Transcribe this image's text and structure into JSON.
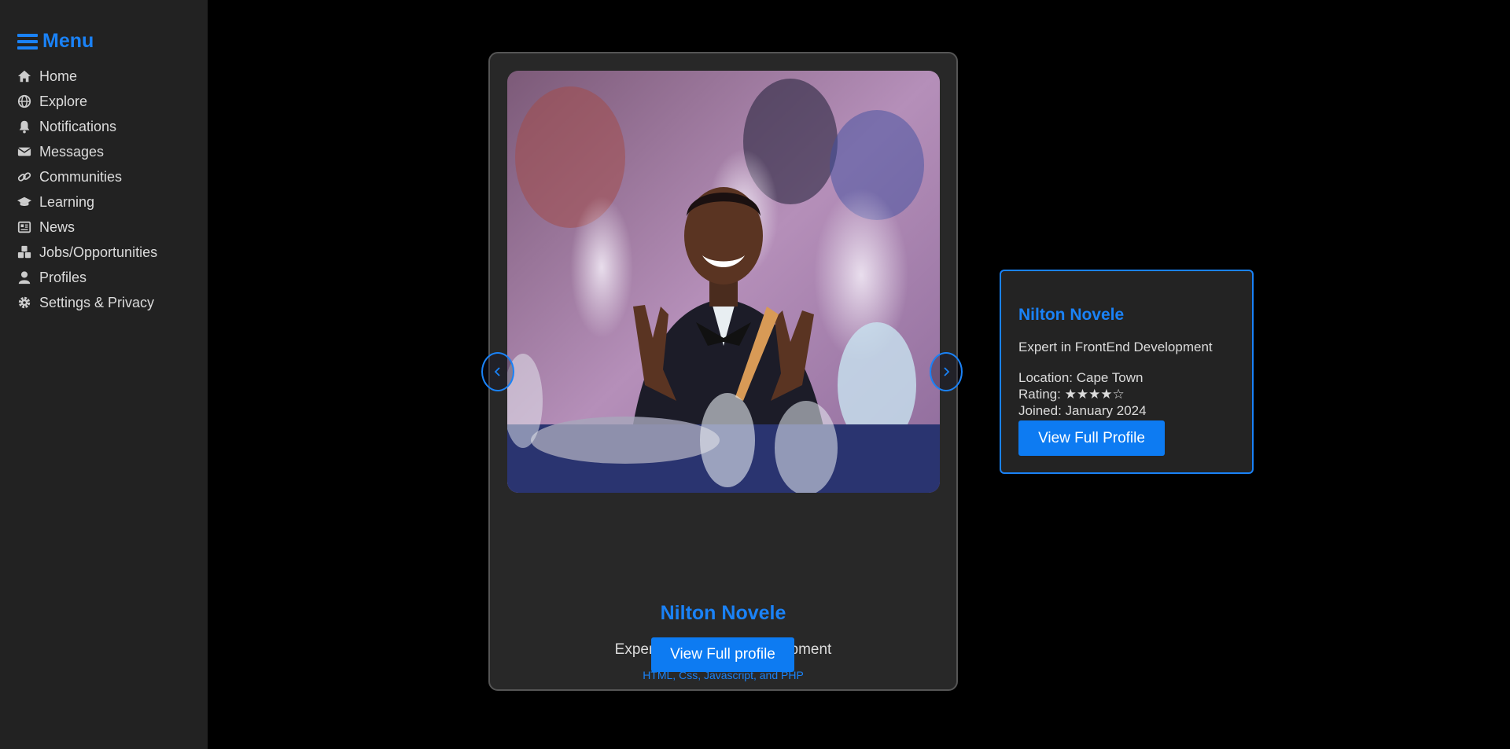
{
  "sidebar": {
    "title": "Menu",
    "items": [
      {
        "label": "Home",
        "icon": "home-icon"
      },
      {
        "label": "Explore",
        "icon": "globe-icon"
      },
      {
        "label": "Notifications",
        "icon": "bell-icon"
      },
      {
        "label": "Messages",
        "icon": "envelope-icon"
      },
      {
        "label": "Communities",
        "icon": "link-icon"
      },
      {
        "label": "Learning",
        "icon": "graduation-cap-icon"
      },
      {
        "label": "News",
        "icon": "newspaper-icon"
      },
      {
        "label": "Jobs/Opportunities",
        "icon": "cubes-icon"
      },
      {
        "label": "Profiles",
        "icon": "user-icon"
      },
      {
        "label": "Settings & Privacy",
        "icon": "gear-icon"
      }
    ]
  },
  "carousel": {
    "prev_icon": "chevron-left-icon",
    "next_icon": "chevron-right-icon"
  },
  "card": {
    "name": "Nilton Novele",
    "title": "Expert in FrontEnd Development",
    "skills": "HTML, Css, Javascript, and PHP",
    "button": "View Full profile"
  },
  "info": {
    "name": "Nilton Novele",
    "title": "Expert in FrontEnd Development",
    "location": "Location: Cape Town",
    "rating": "Rating: ★★★★☆",
    "rating_value": 4,
    "rating_max": 5,
    "joined": "Joined: January 2024",
    "button": "View Full Profile"
  },
  "colors": {
    "accent": "#1a82f7",
    "button": "#0d7bf2",
    "sidebar_bg": "#222222",
    "page_bg": "#000000",
    "card_bg": "#282828"
  }
}
